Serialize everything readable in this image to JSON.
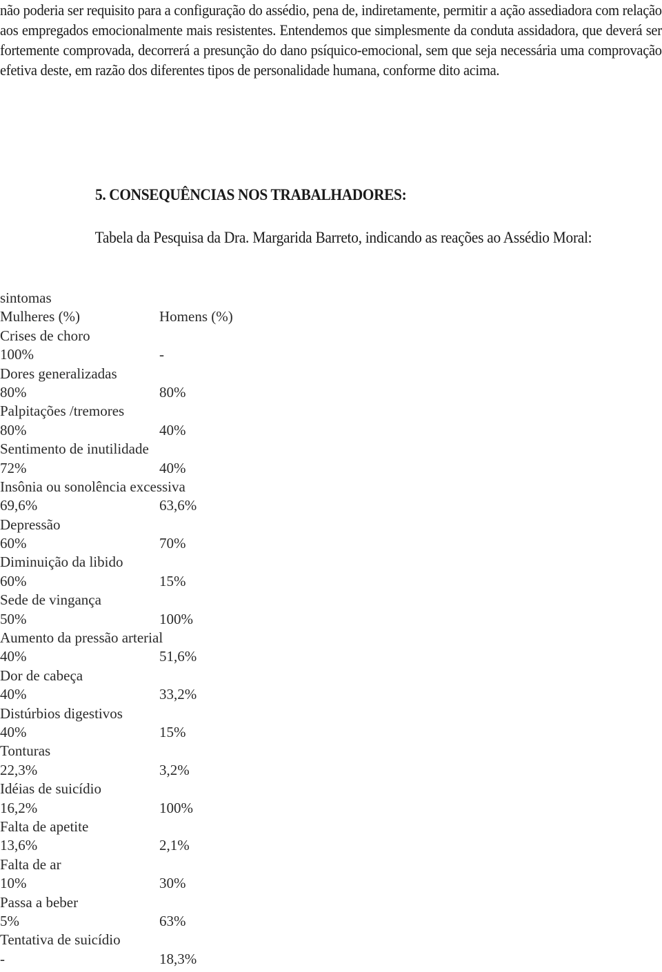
{
  "document": {
    "intro_paragraph": "não poderia ser requisito para a configuração do assédio, pena de, indiretamente, permitir a ação assediadora com relação aos empregados emocionalmente mais resistentes. Entendemos que simplesmente da conduta assidadora, que deverá ser fortemente comprovada, decorrerá a presunção do dano psíquico-emocional, sem que seja necessária uma comprovação efetiva deste, em razão dos diferentes tipos de personalidade humana, conforme dito acima.",
    "section_heading": "5. CONSEQUÊNCIAS NOS TRABALHADORES:",
    "lead_paragraph": "Tabela da Pesquisa da Dra. Margarida Barreto, indicando as reações ao Assédio Moral:"
  },
  "table": {
    "title": "sintomas",
    "headers": {
      "women": "Mulheres (%)",
      "men": "Homens (%)"
    },
    "rows": [
      {
        "symptom": "Crises de choro",
        "women": "100%",
        "men": "-"
      },
      {
        "symptom": "Dores generalizadas",
        "women": "80%",
        "men": "80%"
      },
      {
        "symptom": "Palpitações /tremores",
        "women": "80%",
        "men": "40%"
      },
      {
        "symptom": "Sentimento de inutilidade",
        "women": "72%",
        "men": "40%"
      },
      {
        "symptom": "Insônia ou sonolência excessiva",
        "women": "69,6%",
        "men": "63,6%"
      },
      {
        "symptom": "Depressão",
        "women": "60%",
        "men": "70%"
      },
      {
        "symptom": "Diminuição da libido",
        "women": "60%",
        "men": "15%"
      },
      {
        "symptom": "Sede de vingança",
        "women": "50%",
        "men": "100%"
      },
      {
        "symptom": "Aumento da pressão arterial",
        "women": "40%",
        "men": "51,6%"
      },
      {
        "symptom": "Dor de cabeça",
        "women": "40%",
        "men": "33,2%"
      },
      {
        "symptom": "Distúrbios digestivos",
        "women": "40%",
        "men": "15%"
      },
      {
        "symptom": "Tonturas",
        "women": "22,3%",
        "men": "3,2%"
      },
      {
        "symptom": "Idéias de suicídio",
        "women": "16,2%",
        "men": "100%"
      },
      {
        "symptom": "Falta de apetite",
        "women": "13,6%",
        "men": "2,1%"
      },
      {
        "symptom": "Falta de ar",
        "women": "10%",
        "men": "30%"
      },
      {
        "symptom": "Passa a beber",
        "women": "5%",
        "men": "63%"
      },
      {
        "symptom": "Tentativa de suicídio",
        "women": "-",
        "men": "18,3%"
      }
    ]
  }
}
